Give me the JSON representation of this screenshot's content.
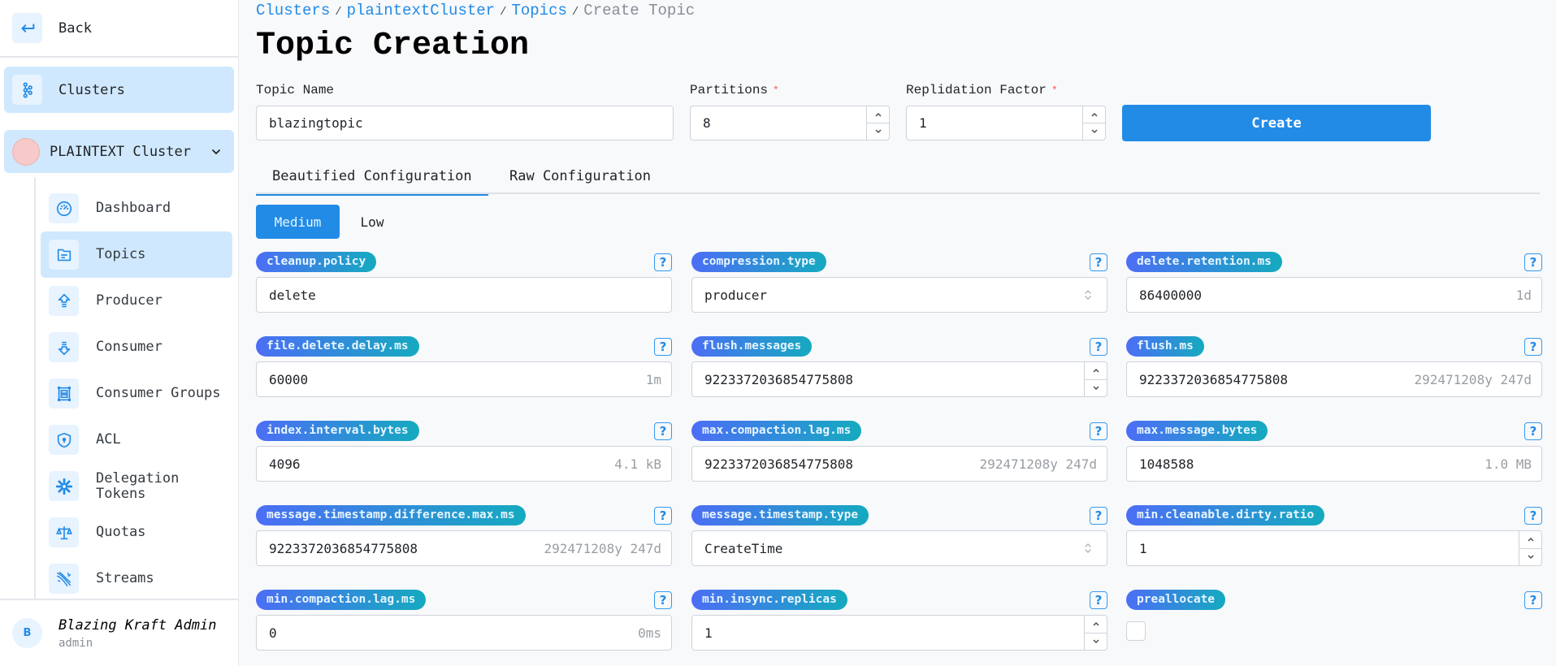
{
  "sidebar": {
    "back_label": "Back",
    "clusters_label": "Clusters",
    "cluster_name": "PLAINTEXT Cluster",
    "items": [
      {
        "label": "Dashboard",
        "icon": "dashboard-gauge-icon",
        "active": false
      },
      {
        "label": "Topics",
        "icon": "folder-icon",
        "active": true
      },
      {
        "label": "Producer",
        "icon": "upload-arrow-icon",
        "active": false
      },
      {
        "label": "Consumer",
        "icon": "download-arrow-icon",
        "active": false
      },
      {
        "label": "Consumer Groups",
        "icon": "group-frame-icon",
        "active": false
      },
      {
        "label": "ACL",
        "icon": "shield-lock-icon",
        "active": false
      },
      {
        "label": "Delegation Tokens",
        "icon": "asterisk-icon",
        "active": false
      },
      {
        "label": "Quotas",
        "icon": "scale-icon",
        "active": false
      },
      {
        "label": "Streams",
        "icon": "streams-icon",
        "active": false
      }
    ],
    "user": {
      "initial": "B",
      "name": "Blazing Kraft Admin",
      "role": "admin"
    }
  },
  "breadcrumb": {
    "items": [
      "Clusters",
      "plaintextCluster",
      "Topics"
    ],
    "current": "Create Topic",
    "separator": "/"
  },
  "page_title": "Topic Creation",
  "form": {
    "topic_name_label": "Topic Name",
    "topic_name_value": "blazingtopic",
    "partitions_label": "Partitions",
    "partitions_value": "8",
    "replication_label": "Replidation Factor",
    "replication_value": "1",
    "required_marker": "*",
    "create_label": "Create"
  },
  "tabs": {
    "beautified": "Beautified Configuration",
    "raw": "Raw Configuration",
    "active": "beautified"
  },
  "importance": {
    "medium": "Medium",
    "low": "Low",
    "active": "medium"
  },
  "help_glyph": "?",
  "configs": [
    {
      "key": "cleanup.policy",
      "value": "delete",
      "hint": "",
      "kind": "text"
    },
    {
      "key": "compression.type",
      "value": "producer",
      "hint": "",
      "kind": "select"
    },
    {
      "key": "delete.retention.ms",
      "value": "86400000",
      "hint": "1d",
      "kind": "text"
    },
    {
      "key": "file.delete.delay.ms",
      "value": "60000",
      "hint": "1m",
      "kind": "text"
    },
    {
      "key": "flush.messages",
      "value": "9223372036854775808",
      "hint": "",
      "kind": "number"
    },
    {
      "key": "flush.ms",
      "value": "9223372036854775808",
      "hint": "292471208y 247d",
      "kind": "text"
    },
    {
      "key": "index.interval.bytes",
      "value": "4096",
      "hint": "4.1 kB",
      "kind": "text"
    },
    {
      "key": "max.compaction.lag.ms",
      "value": "9223372036854775808",
      "hint": "292471208y 247d",
      "kind": "text"
    },
    {
      "key": "max.message.bytes",
      "value": "1048588",
      "hint": "1.0 MB",
      "kind": "text"
    },
    {
      "key": "message.timestamp.difference.max.ms",
      "value": "9223372036854775808",
      "hint": "292471208y 247d",
      "kind": "text"
    },
    {
      "key": "message.timestamp.type",
      "value": "CreateTime",
      "hint": "",
      "kind": "select"
    },
    {
      "key": "min.cleanable.dirty.ratio",
      "value": "1",
      "hint": "",
      "kind": "number"
    },
    {
      "key": "min.compaction.lag.ms",
      "value": "0",
      "hint": "0ms",
      "kind": "text"
    },
    {
      "key": "min.insync.replicas",
      "value": "1",
      "hint": "",
      "kind": "number"
    },
    {
      "key": "preallocate",
      "value": "false",
      "hint": "",
      "kind": "checkbox"
    }
  ]
}
